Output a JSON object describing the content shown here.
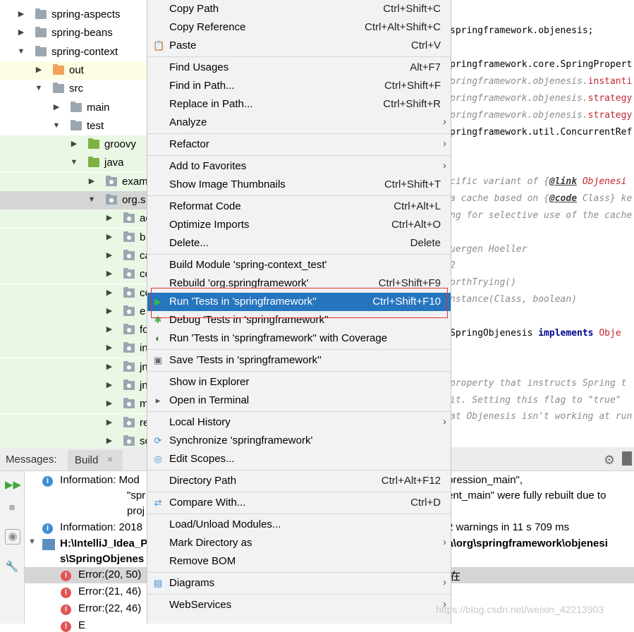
{
  "tree": {
    "rows": [
      {
        "label": "spring-aspects",
        "depth": 0,
        "arrow": "▶",
        "icon": "gray",
        "bg": "#ffffff"
      },
      {
        "label": "spring-beans",
        "depth": 0,
        "arrow": "▶",
        "icon": "gray",
        "bg": "#ffffff"
      },
      {
        "label": "spring-context",
        "depth": 0,
        "arrow": "▼",
        "icon": "gray",
        "bg": "#ffffff"
      },
      {
        "label": "out",
        "depth": 1,
        "arrow": "▶",
        "icon": "orange",
        "bg": "#fdfde3"
      },
      {
        "label": "src",
        "depth": 1,
        "arrow": "▼",
        "icon": "gray",
        "bg": "#ffffff"
      },
      {
        "label": "main",
        "depth": 2,
        "arrow": "▶",
        "icon": "gray",
        "bg": "#ffffff"
      },
      {
        "label": "test",
        "depth": 2,
        "arrow": "▼",
        "icon": "gray",
        "bg": "#ffffff"
      },
      {
        "label": "groovy",
        "depth": 3,
        "arrow": "▶",
        "icon": "green",
        "bg": "#ebf7e5"
      },
      {
        "label": "java",
        "depth": 3,
        "arrow": "▼",
        "icon": "green",
        "bg": "#ebf7e5"
      },
      {
        "label": "exam",
        "depth": 4,
        "arrow": "▶",
        "icon": "pkg",
        "bg": "#ebf7e5"
      },
      {
        "label": "org.s",
        "depth": 4,
        "arrow": "▼",
        "icon": "pkg",
        "bg": "#d5d5d5"
      },
      {
        "label": "ac",
        "depth": 5,
        "arrow": "▶",
        "icon": "pkg",
        "bg": "#ebf7e5"
      },
      {
        "label": "b",
        "depth": 5,
        "arrow": "▶",
        "icon": "pkg",
        "bg": "#ebf7e5"
      },
      {
        "label": "ca",
        "depth": 5,
        "arrow": "▶",
        "icon": "pkg",
        "bg": "#ebf7e5"
      },
      {
        "label": "co",
        "depth": 5,
        "arrow": "▶",
        "icon": "pkg",
        "bg": "#ebf7e5"
      },
      {
        "label": "co",
        "depth": 5,
        "arrow": "▶",
        "icon": "pkg",
        "bg": "#ebf7e5"
      },
      {
        "label": "e",
        "depth": 5,
        "arrow": "▶",
        "icon": "pkg",
        "bg": "#ebf7e5"
      },
      {
        "label": "fo",
        "depth": 5,
        "arrow": "▶",
        "icon": "pkg",
        "bg": "#ebf7e5"
      },
      {
        "label": "in",
        "depth": 5,
        "arrow": "▶",
        "icon": "pkg",
        "bg": "#ebf7e5"
      },
      {
        "label": "jn",
        "depth": 5,
        "arrow": "▶",
        "icon": "pkg",
        "bg": "#ebf7e5"
      },
      {
        "label": "jn",
        "depth": 5,
        "arrow": "▶",
        "icon": "pkg",
        "bg": "#ebf7e5"
      },
      {
        "label": "m",
        "depth": 5,
        "arrow": "▶",
        "icon": "pkg",
        "bg": "#ebf7e5"
      },
      {
        "label": "re",
        "depth": 5,
        "arrow": "▶",
        "icon": "pkg",
        "bg": "#ebf7e5"
      },
      {
        "label": "sc",
        "depth": 5,
        "arrow": "▶",
        "icon": "pkg",
        "bg": "#ebf7e5"
      }
    ]
  },
  "editor": {
    "lines": [
      {
        "parts": [
          {
            "t": "springframework.objenesis;",
            "c": ""
          }
        ],
        "style": ""
      },
      {
        "parts": [
          {
            "t": "pringframework.core.SpringPropert",
            "c": ""
          }
        ],
        "style": ""
      },
      {
        "parts": [
          {
            "t": "pringframework.objenesis.",
            "c": "ital"
          },
          {
            "t": "instanti",
            "c": "red"
          }
        ],
        "style": ""
      },
      {
        "parts": [
          {
            "t": "pringframework.objenesis.",
            "c": "ital"
          },
          {
            "t": "strategy",
            "c": "red"
          }
        ],
        "style": ""
      },
      {
        "parts": [
          {
            "t": "pringframework.objenesis.",
            "c": "ital"
          },
          {
            "t": "strategy",
            "c": "red"
          }
        ],
        "style": ""
      },
      {
        "parts": [
          {
            "t": "pringframework.util.ConcurrentRef",
            "c": ""
          }
        ],
        "style": ""
      },
      {
        "parts": [
          {
            "t": "cific variant of {",
            "c": ""
          },
          {
            "t": "@link",
            "c": "tag"
          },
          {
            "t": " Objenesi",
            "c": "red"
          }
        ],
        "style": "cmt"
      },
      {
        "parts": [
          {
            "t": "a cache based on {",
            "c": ""
          },
          {
            "t": "@code",
            "c": "tag"
          },
          {
            "t": " Class} ke",
            "c": ""
          }
        ],
        "style": "cmt"
      },
      {
        "parts": [
          {
            "t": "ng for selective use of the cache",
            "c": ""
          }
        ],
        "style": "cmt"
      },
      {
        "parts": [
          {
            "t": "uergen Hoeller",
            "c": ""
          }
        ],
        "style": "cmt"
      },
      {
        "parts": [
          {
            "t": "2",
            "c": ""
          }
        ],
        "style": "cmt"
      },
      {
        "parts": [
          {
            "t": "orthTrying()",
            "c": ""
          }
        ],
        "style": "cmt"
      },
      {
        "parts": [
          {
            "t": "nstance(",
            "c": ""
          },
          {
            "t": "Class",
            "c": ""
          },
          {
            "t": ", boolean)",
            "c": ""
          }
        ],
        "style": "cmt"
      },
      {
        "parts": [
          {
            "t": "  SpringObjenesis ",
            "c": ""
          },
          {
            "t": "implements",
            "c": "kw"
          },
          {
            "t": " Obje",
            "c": "red"
          }
        ],
        "style": ""
      },
      {
        "parts": [
          {
            "t": " property that instructs Spring t",
            "c": ""
          }
        ],
        "style": "cmt"
      },
      {
        "parts": [
          {
            "t": " it. Setting this flag to \"true\"",
            "c": ""
          }
        ],
        "style": "cmt"
      },
      {
        "parts": [
          {
            "t": "at Objenesis isn't working at run",
            "c": ""
          }
        ],
        "style": "cmt"
      }
    ]
  },
  "messages": {
    "label": "Messages:",
    "build_tab": "Build",
    "close_glyph": "×",
    "info1_a": "Information: Mod",
    "info1_b": "pression_main\",",
    "info1_c": "\"spr",
    "info1_d": "ent_main\" were fully rebuilt due to",
    "info1_e": "proj",
    "info2_a": "Information: 2018",
    "info2_b": "2 warnings in 11 s 709 ms",
    "path_a": "H:\\IntelliJ_Idea_P",
    "path_b": "va\\org\\springframework\\objenesi",
    "path_c": "s\\SpringObjenes",
    "err_rows": [
      "Error:(20, 50)",
      "Error:(21, 46)",
      "Error:(22, 46)",
      "E"
    ],
    "err_suffix": "在"
  },
  "menu": {
    "items": [
      {
        "label": "Copy Path",
        "shortcut": "Ctrl+Shift+C",
        "sub": false,
        "icon": "",
        "sepBefore": false
      },
      {
        "label": "Copy Reference",
        "shortcut": "Ctrl+Alt+Shift+C",
        "sub": false,
        "icon": "",
        "sepBefore": false
      },
      {
        "label": "Paste",
        "shortcut": "Ctrl+V",
        "sub": false,
        "icon": "paste-icon",
        "sepBefore": false
      },
      {
        "label": "Find Usages",
        "shortcut": "Alt+F7",
        "sub": false,
        "icon": "",
        "sepBefore": true
      },
      {
        "label": "Find in Path...",
        "shortcut": "Ctrl+Shift+F",
        "sub": false,
        "icon": "",
        "sepBefore": false
      },
      {
        "label": "Replace in Path...",
        "shortcut": "Ctrl+Shift+R",
        "sub": false,
        "icon": "",
        "sepBefore": false
      },
      {
        "label": "Analyze",
        "shortcut": "",
        "sub": true,
        "icon": "",
        "sepBefore": false
      },
      {
        "label": "Refactor",
        "shortcut": "",
        "sub": true,
        "icon": "",
        "sepBefore": true
      },
      {
        "label": "Add to Favorites",
        "shortcut": "",
        "sub": true,
        "icon": "",
        "sepBefore": true
      },
      {
        "label": "Show Image Thumbnails",
        "shortcut": "Ctrl+Shift+T",
        "sub": false,
        "icon": "",
        "sepBefore": false
      },
      {
        "label": "Reformat Code",
        "shortcut": "Ctrl+Alt+L",
        "sub": false,
        "icon": "",
        "sepBefore": true
      },
      {
        "label": "Optimize Imports",
        "shortcut": "Ctrl+Alt+O",
        "sub": false,
        "icon": "",
        "sepBefore": false
      },
      {
        "label": "Delete...",
        "shortcut": "Delete",
        "sub": false,
        "icon": "",
        "sepBefore": false
      },
      {
        "label": "Build Module 'spring-context_test'",
        "shortcut": "",
        "sub": false,
        "icon": "",
        "sepBefore": true
      },
      {
        "label": "Rebuild 'org.springframework'",
        "shortcut": "Ctrl+Shift+F9",
        "sub": false,
        "icon": "",
        "sepBefore": false
      },
      {
        "label": "Run 'Tests in 'springframework''",
        "shortcut": "Ctrl+Shift+F10",
        "sub": false,
        "icon": "run-icon",
        "sepBefore": false,
        "selected": true
      },
      {
        "label": "Debug 'Tests in 'springframework''",
        "shortcut": "",
        "sub": false,
        "icon": "debug-icon",
        "sepBefore": false
      },
      {
        "label": "Run 'Tests in 'springframework'' with Coverage",
        "shortcut": "",
        "sub": false,
        "icon": "coverage-icon",
        "sepBefore": false
      },
      {
        "label": "Save 'Tests in 'springframework''",
        "shortcut": "",
        "sub": false,
        "icon": "save-config-icon",
        "sepBefore": true
      },
      {
        "label": "Show in Explorer",
        "shortcut": "",
        "sub": false,
        "icon": "",
        "sepBefore": true
      },
      {
        "label": "Open in Terminal",
        "shortcut": "",
        "sub": false,
        "icon": "terminal-icon",
        "sepBefore": false
      },
      {
        "label": "Local History",
        "shortcut": "",
        "sub": true,
        "icon": "",
        "sepBefore": true
      },
      {
        "label": "Synchronize 'springframework'",
        "shortcut": "",
        "sub": false,
        "icon": "sync-icon",
        "sepBefore": false
      },
      {
        "label": "Edit Scopes...",
        "shortcut": "",
        "sub": false,
        "icon": "scopes-icon",
        "sepBefore": false
      },
      {
        "label": "Directory Path",
        "shortcut": "Ctrl+Alt+F12",
        "sub": false,
        "icon": "",
        "sepBefore": true
      },
      {
        "label": "Compare With...",
        "shortcut": "Ctrl+D",
        "sub": false,
        "icon": "compare-icon",
        "sepBefore": true
      },
      {
        "label": "Load/Unload Modules...",
        "shortcut": "",
        "sub": false,
        "icon": "",
        "sepBefore": true
      },
      {
        "label": "Mark Directory as",
        "shortcut": "",
        "sub": true,
        "icon": "",
        "sepBefore": false
      },
      {
        "label": "Remove BOM",
        "shortcut": "",
        "sub": false,
        "icon": "",
        "sepBefore": false
      },
      {
        "label": "Diagrams",
        "shortcut": "",
        "sub": true,
        "icon": "diagrams-icon",
        "sepBefore": true
      },
      {
        "label": "WebServices",
        "shortcut": "",
        "sub": true,
        "icon": "",
        "sepBefore": true
      }
    ],
    "submenu_arrow": "›"
  },
  "watermark": "https://blog.csdn.net/weixin_42213903",
  "colors": {
    "selection": "#2675bf",
    "highlight_box": "#e03030",
    "green_tree": "#ebf7e5"
  }
}
